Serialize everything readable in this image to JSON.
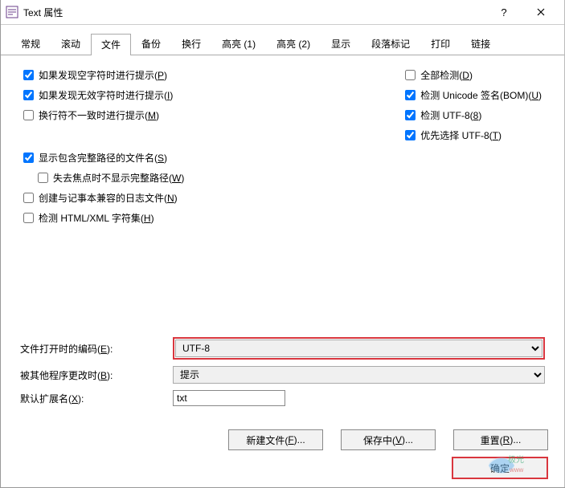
{
  "window": {
    "title": "Text 属性"
  },
  "tabs": {
    "items": [
      "常规",
      "滚动",
      "文件",
      "备份",
      "换行",
      "高亮 (1)",
      "高亮 (2)",
      "显示",
      "段落标记",
      "打印",
      "链接"
    ],
    "active_index": 2
  },
  "left_checks": [
    {
      "label_pre": "如果发现空字符时进行提示(",
      "mn": "P",
      "label_post": ")",
      "checked": true
    },
    {
      "label_pre": "如果发现无效字符时进行提示(",
      "mn": "I",
      "label_post": ")",
      "checked": true
    },
    {
      "label_pre": "换行符不一致时进行提示(",
      "mn": "M",
      "label_post": ")",
      "checked": false
    }
  ],
  "left_checks2": [
    {
      "label_pre": "显示包含完整路径的文件名(",
      "mn": "S",
      "label_post": ")",
      "checked": true,
      "indent": false
    },
    {
      "label_pre": "失去焦点时不显示完整路径(",
      "mn": "W",
      "label_post": ")",
      "checked": false,
      "indent": true
    },
    {
      "label_pre": "创建与记事本兼容的日志文件(",
      "mn": "N",
      "label_post": ")",
      "checked": false,
      "indent": false
    },
    {
      "label_pre": "检测 HTML/XML 字符集(",
      "mn": "H",
      "label_post": ")",
      "checked": false,
      "indent": false
    }
  ],
  "right_checks": [
    {
      "label_pre": "全部检测(",
      "mn": "D",
      "label_post": ")",
      "checked": false
    },
    {
      "label_pre": "检测 Unicode 签名(BOM)(",
      "mn": "U",
      "label_post": ")",
      "checked": true
    },
    {
      "label_pre": "检测 UTF-8(",
      "mn": "8",
      "label_post": ")",
      "checked": true
    },
    {
      "label_pre": "优先选择 UTF-8(",
      "mn": "T",
      "label_post": ")",
      "checked": true
    }
  ],
  "form": {
    "encoding_label_pre": "文件打开时的编码(",
    "encoding_mn": "E",
    "encoding_label_post": "):",
    "encoding_value": "UTF-8",
    "modified_label_pre": "被其他程序更改时(",
    "modified_mn": "B",
    "modified_label_post": "):",
    "modified_value": "提示",
    "ext_label_pre": "默认扩展名(",
    "ext_mn": "X",
    "ext_label_post": "):",
    "ext_value": "txt"
  },
  "buttons": {
    "newfile_pre": "新建文件(",
    "newfile_mn": "F",
    "newfile_post": ")...",
    "saving_pre": "保存中(",
    "saving_mn": "V",
    "saving_post": ")...",
    "reset_pre": "重置(",
    "reset_mn": "R",
    "reset_post": ")...",
    "ok": "确定"
  }
}
